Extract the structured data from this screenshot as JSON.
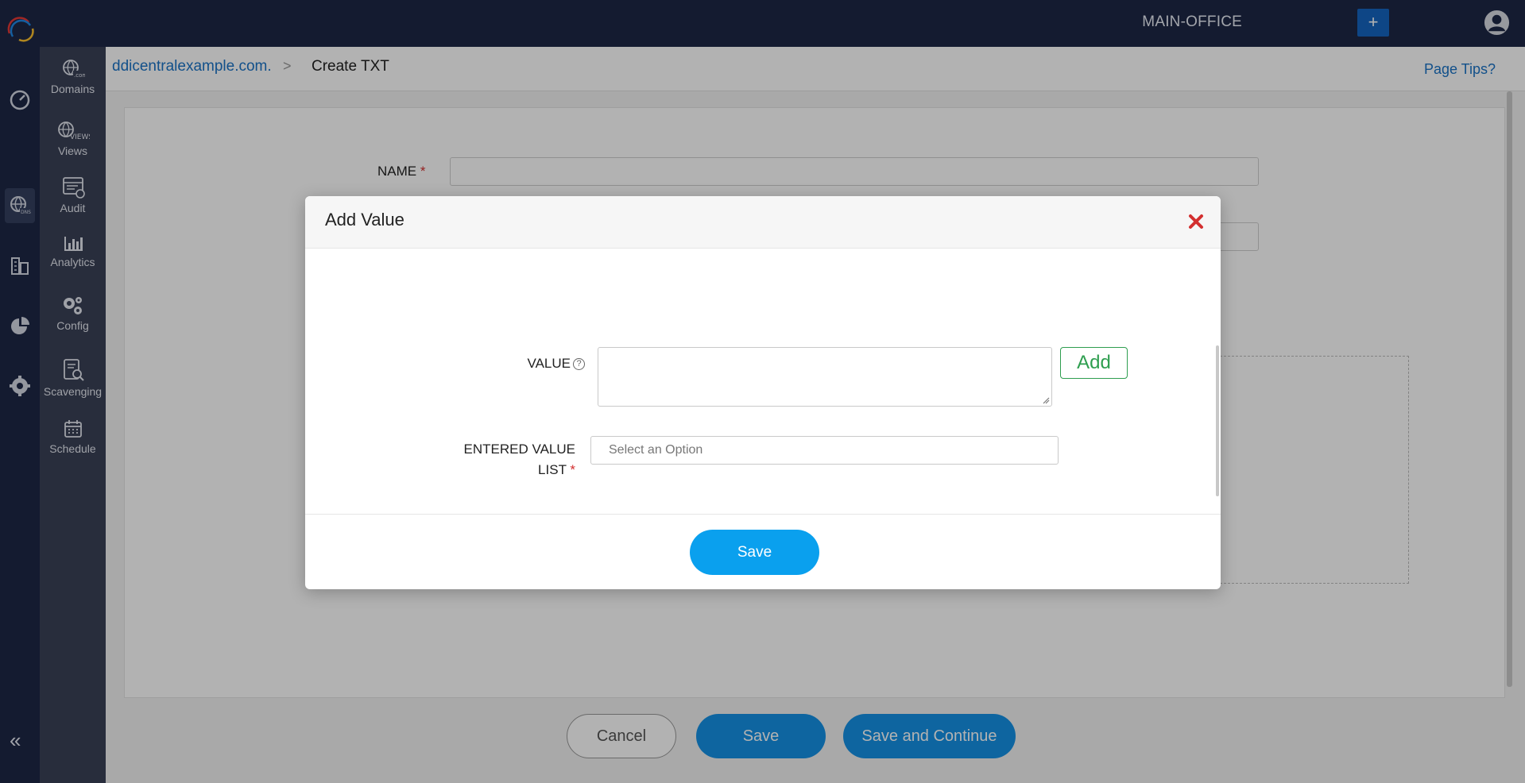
{
  "topbar": {
    "site": "MAIN-OFFICE",
    "plus": "+"
  },
  "sidebar": {
    "items": [
      {
        "label": "Domains",
        "icon": "domains-globe-icon"
      },
      {
        "label": "Views",
        "icon": "views-globe-icon"
      },
      {
        "label": "Audit",
        "icon": "audit-icon"
      },
      {
        "label": "Analytics",
        "icon": "analytics-chart-icon"
      },
      {
        "label": "Config",
        "icon": "config-gears-icon"
      },
      {
        "label": "Scavenging",
        "icon": "scavenging-icon"
      },
      {
        "label": "Schedule",
        "icon": "schedule-calendar-icon"
      }
    ],
    "collapse": "«"
  },
  "breadcrumb": {
    "domain": "ddicentralexample.com.",
    "separator": ">",
    "current": "Create TXT"
  },
  "page_tips": "Page Tips?",
  "form": {
    "name_label": "NAME",
    "required_mark": "*"
  },
  "footer": {
    "cancel": "Cancel",
    "save": "Save",
    "save_continue": "Save and Continue"
  },
  "modal": {
    "title": "Add Value",
    "value_label": "VALUE",
    "help": "?",
    "add": "Add",
    "entered_label_1": "ENTERED VALUE",
    "entered_label_2": "LIST",
    "select_placeholder": "Select an Option",
    "save": "Save",
    "close_color": "#d32f2f"
  },
  "colors": {
    "topbar": "#1e2746",
    "accent": "#1591e6",
    "add_green": "#2e9e4f"
  }
}
